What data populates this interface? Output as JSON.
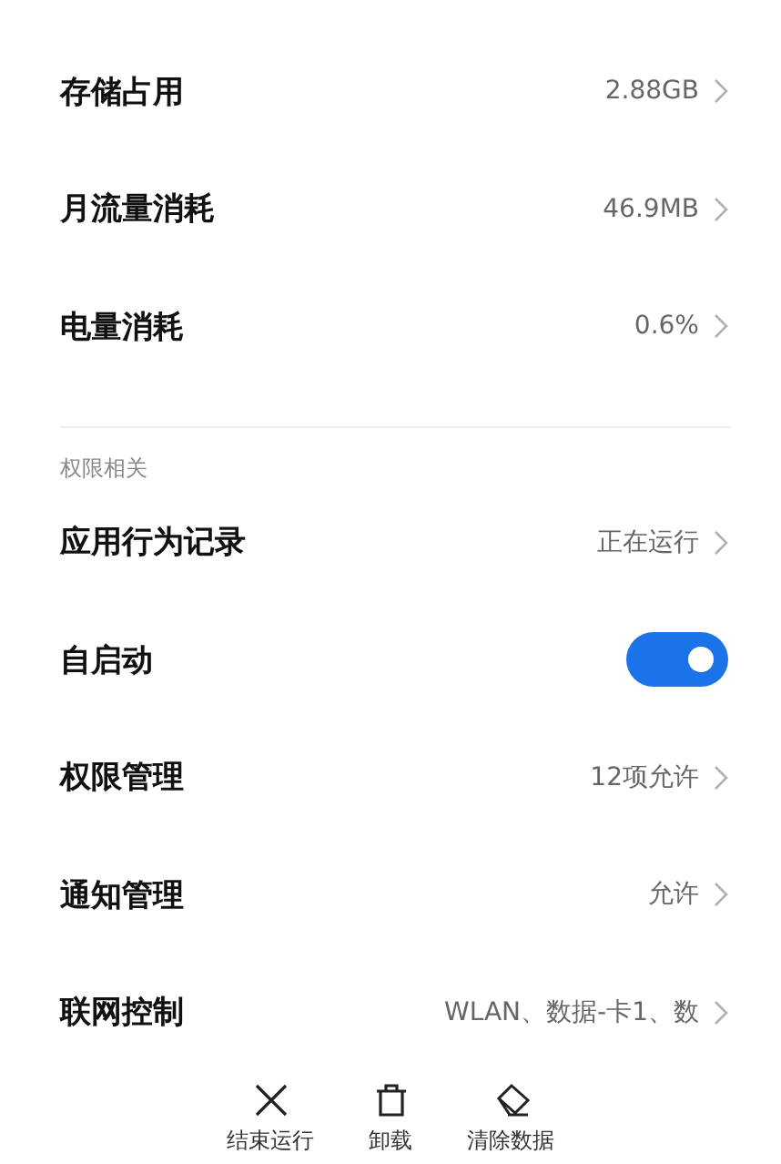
{
  "usage_items": [
    {
      "kind": "nav",
      "label": "存储占用",
      "value": "2.88GB"
    },
    {
      "kind": "nav",
      "label": "月流量消耗",
      "value": "46.9MB"
    },
    {
      "kind": "nav",
      "label": "电量消耗",
      "value": "0.6%"
    }
  ],
  "permissions": {
    "header": "权限相关",
    "items": [
      {
        "kind": "nav",
        "label": "应用行为记录",
        "value": "正在运行"
      },
      {
        "kind": "toggle",
        "label": "自启动",
        "on": true
      },
      {
        "kind": "nav",
        "label": "权限管理",
        "value": "12项允许"
      },
      {
        "kind": "nav",
        "label": "通知管理",
        "value": "允许"
      },
      {
        "kind": "nav",
        "label": "联网控制",
        "value": "WLAN、数据-卡1、数"
      }
    ]
  },
  "actions": [
    {
      "kind": "close",
      "label": "结束运行"
    },
    {
      "kind": "trash",
      "label": "卸载"
    },
    {
      "kind": "eraser",
      "label": "清除数据"
    }
  ]
}
